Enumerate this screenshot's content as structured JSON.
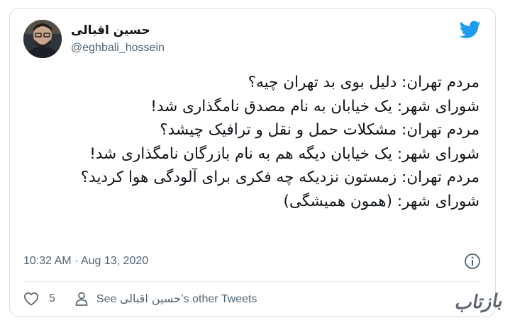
{
  "author": {
    "name": "حسین اقبالی",
    "handle": "@eghbali_hossein"
  },
  "tweet": {
    "lines": [
      "مردم تهران: دلیل بوی بد تهران چیه؟",
      "شورای شهر: یک خیابان به نام مصدق نامگذاری شد!",
      "مردم تهران: مشکلات حمل و نقل و ترافیک چیشد؟",
      "شورای شهر: یک خیابان دیگه هم به نام بازرگان نامگذاری شد!",
      "مردم تهران: زمستون نزدیکه چه فکری برای آلودگی هوا کردید؟",
      "شورای شهر: (همون همیشگی)"
    ],
    "timestamp": "10:32 AM · Aug 13, 2020"
  },
  "actions": {
    "like_count": "5",
    "see_prefix": "See ",
    "see_name": "حسین اقبالی",
    "see_suffix": "’s other Tweets"
  },
  "watermark": "بازتاب",
  "colors": {
    "twitter_blue": "#1d9bf0",
    "secondary_text": "#536471",
    "border": "#d6dde3"
  },
  "icons": [
    "twitter-bird-icon",
    "info-icon",
    "heart-icon",
    "person-icon"
  ]
}
